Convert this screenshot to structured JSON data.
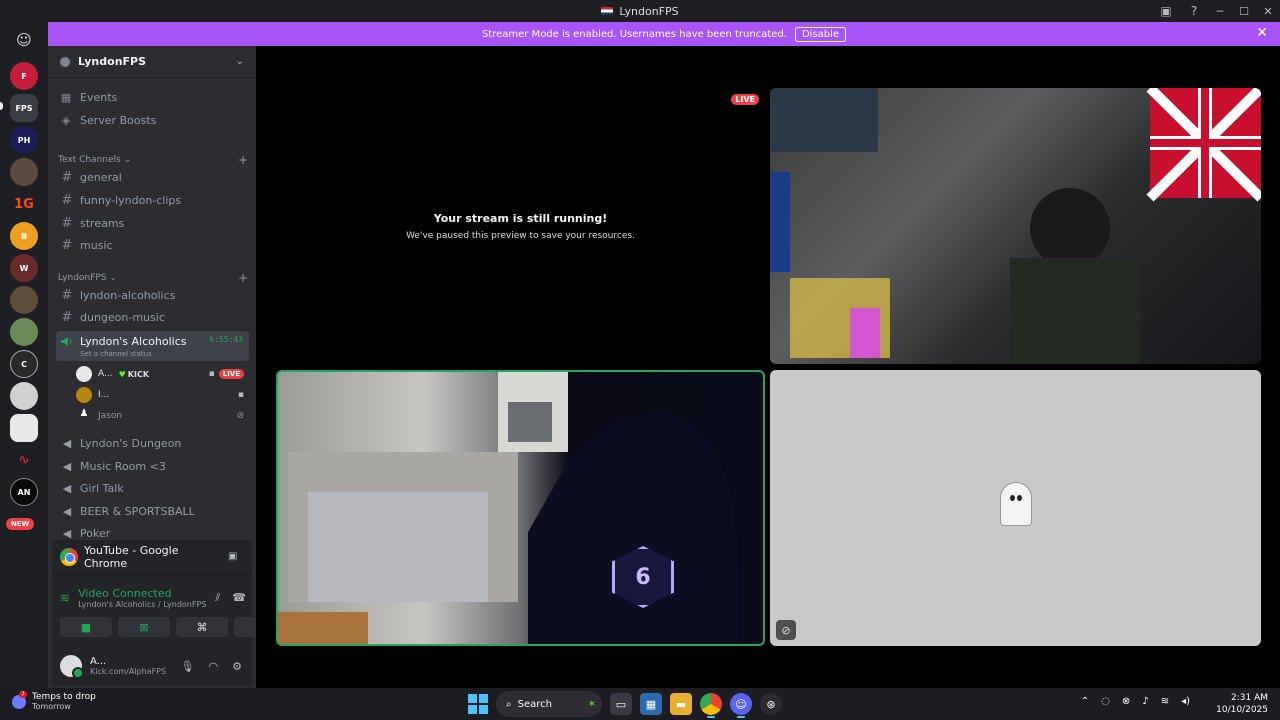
{
  "window": {
    "title": "LyndonFPS"
  },
  "banner": {
    "text": "Streamer Mode is enabled. Usernames have been truncated.",
    "button": "Disable"
  },
  "rail": {
    "new_badge": "NEW"
  },
  "guild": {
    "name": "LyndonFPS"
  },
  "nav": [
    {
      "label": "Events",
      "icon": "calendar-icon"
    },
    {
      "label": "Server Boosts",
      "icon": "boost-icon"
    }
  ],
  "categories": {
    "text": "Text Channels",
    "lyndon": "LyndonFPS"
  },
  "text_channels": [
    "general",
    "funny-lyndon-clips",
    "streams",
    "music"
  ],
  "lyndon_channels": [
    "lyndon-alcoholics",
    "dungeon-music"
  ],
  "active_voice": {
    "name": "Lyndon's Alcoholics",
    "timer": "6:55:43",
    "status": "Set a channel status"
  },
  "voice_users": [
    {
      "name": "A...",
      "tag": "KICK",
      "live": "LIVE"
    },
    {
      "name": "I..."
    },
    {
      "name": "Jason"
    }
  ],
  "voice_channels": [
    "Lyndon's Dungeon",
    "Music Room <3",
    "Girl Talk",
    "BEER & SPORTSBALL",
    "Poker"
  ],
  "share": {
    "label": "YouTube - Google Chrome"
  },
  "rtc": {
    "status": "Video Connected",
    "location": "Lyndon's Alcoholics / LyndonFPS"
  },
  "user": {
    "name": "A...",
    "status": "Kick.com/AlphaFPS"
  },
  "stage": {
    "paused_title": "Your stream is still running!",
    "paused_sub": "We've paused this preview to save your resources.",
    "live": "LIVE"
  },
  "taskbar": {
    "weather_title": "Temps to drop",
    "weather_sub": "Tomorrow",
    "weather_badge": "7",
    "search": "Search",
    "time": "2:31 AM",
    "date": "10/10/2025"
  },
  "colors": {
    "accent": "#a855f7",
    "online": "#23a55a",
    "live": "#ed4245"
  }
}
